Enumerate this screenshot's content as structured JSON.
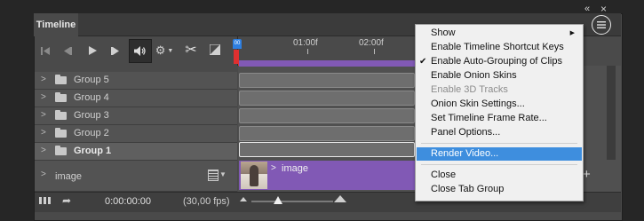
{
  "window": {
    "collapse_glyph": "«",
    "close_glyph": "×"
  },
  "tab": {
    "label": "Timeline"
  },
  "ruler": {
    "marks": [
      "01:00f",
      "02:00f"
    ],
    "playhead_label": "00"
  },
  "layers": [
    {
      "label": "Group 5",
      "bold": false
    },
    {
      "label": "Group 4",
      "bold": false
    },
    {
      "label": "Group 3",
      "bold": false
    },
    {
      "label": "Group 2",
      "bold": false
    },
    {
      "label": "Group 1",
      "bold": true
    }
  ],
  "video_layer": {
    "label": "image",
    "clip_label": "image"
  },
  "footer": {
    "timecode": "0:00:00:00",
    "fps": "(30,00 fps)"
  },
  "menu": {
    "items": [
      {
        "label": "Show",
        "submenu": true,
        "checked": false,
        "disabled": false,
        "highlighted": false
      },
      {
        "label": "Enable Timeline Shortcut Keys",
        "checked": false,
        "disabled": false,
        "highlighted": false
      },
      {
        "label": "Enable Auto-Grouping of Clips",
        "checked": true,
        "disabled": false,
        "highlighted": false
      },
      {
        "label": "Enable Onion Skins",
        "checked": false,
        "disabled": false,
        "highlighted": false
      },
      {
        "label": "Enable 3D Tracks",
        "checked": false,
        "disabled": true,
        "highlighted": false
      },
      {
        "label": "Onion Skin Settings...",
        "checked": false,
        "disabled": false,
        "highlighted": false
      },
      {
        "label": "Set Timeline Frame Rate...",
        "checked": false,
        "disabled": false,
        "highlighted": false
      },
      {
        "label": "Panel Options...",
        "checked": false,
        "disabled": false,
        "highlighted": false
      },
      {
        "label": "Render Video...",
        "checked": false,
        "disabled": false,
        "highlighted": true
      },
      {
        "label": "Close",
        "checked": false,
        "disabled": false,
        "highlighted": false
      },
      {
        "label": "Close Tab Group",
        "checked": false,
        "disabled": false,
        "highlighted": false
      }
    ],
    "check_glyph": "✔",
    "submenu_glyph": "▶"
  },
  "colors": {
    "clip_purple": "#8159b5",
    "menu_highlight": "#3e8ede",
    "playhead": "#2e7fe0",
    "work_marker": "#e03030"
  }
}
